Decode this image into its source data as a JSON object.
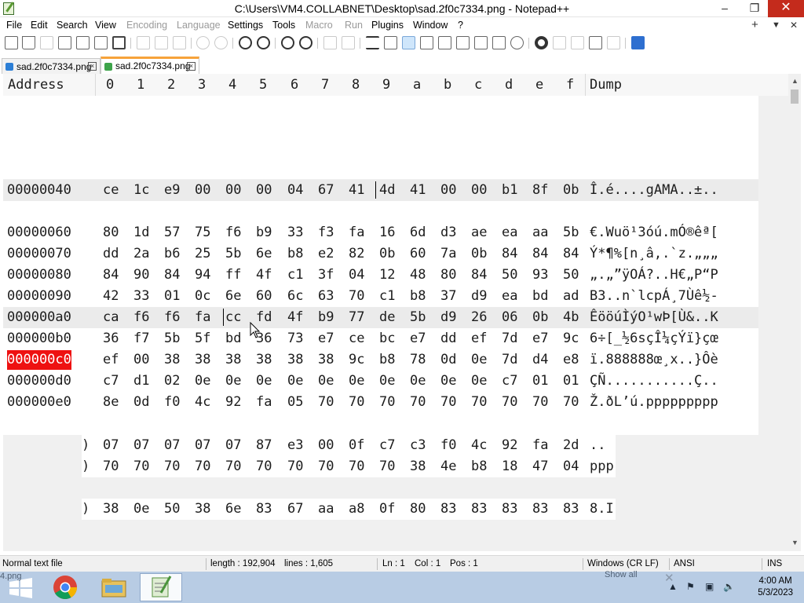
{
  "window": {
    "title": "C:\\Users\\VM4.COLLABNET\\Desktop\\sad.2f0c7334.png - Notepad++",
    "controls": [
      "–",
      "❐",
      "✕"
    ]
  },
  "menu": {
    "items": [
      "File",
      "Edit",
      "Search",
      "View",
      "Encoding",
      "Language",
      "Settings",
      "Tools",
      "Macro",
      "Run",
      "Plugins",
      "Window",
      "?"
    ],
    "disabled": [
      "Encoding",
      "Language",
      "Macro",
      "Run"
    ],
    "right": [
      "+",
      "▼",
      "✕"
    ]
  },
  "tabs": [
    {
      "label": "sad.2f0c7334.png",
      "active": false
    },
    {
      "label": "sad.2f0c7334.png",
      "active": true
    }
  ],
  "hex": {
    "header": {
      "address": "Address",
      "columns": [
        "0",
        "1",
        "2",
        "3",
        "4",
        "5",
        "6",
        "7",
        "8",
        "9",
        "a",
        "b",
        "c",
        "d",
        "e",
        "f"
      ],
      "dump": "Dump"
    },
    "rows": [
      {
        "address": "00000040",
        "bytes": [
          "ce",
          "1c",
          "e9",
          "00",
          "00",
          "00",
          "04",
          "67",
          "41",
          "4d",
          "41",
          "00",
          "00",
          "b1",
          "8f",
          "0b"
        ],
        "dump": "Î.é....gAMA..±.."
      },
      {
        "address": "00000060",
        "bytes": [
          "80",
          "1d",
          "57",
          "75",
          "f6",
          "b9",
          "33",
          "f3",
          "fa",
          "16",
          "6d",
          "d3",
          "ae",
          "ea",
          "aa",
          "5b"
        ],
        "dump": "€.Wuö¹3óú.mÓ®êª["
      },
      {
        "address": "00000070",
        "bytes": [
          "dd",
          "2a",
          "b6",
          "25",
          "5b",
          "6e",
          "b8",
          "e2",
          "82",
          "0b",
          "60",
          "7a",
          "0b",
          "84",
          "84",
          "84"
        ],
        "dump": "Ý*¶%[n¸â‚.`z.„„„"
      },
      {
        "address": "00000080",
        "bytes": [
          "84",
          "90",
          "84",
          "94",
          "ff",
          "4f",
          "c1",
          "3f",
          "04",
          "12",
          "48",
          "80",
          "84",
          "50",
          "93",
          "50"
        ],
        "dump": "„.„”ÿOÁ?..H€„P“P"
      },
      {
        "address": "00000090",
        "bytes": [
          "42",
          "33",
          "01",
          "0c",
          "6e",
          "60",
          "6c",
          "63",
          "70",
          "c1",
          "b8",
          "37",
          "d9",
          "ea",
          "bd",
          "ad"
        ],
        "dump": "B3..n`lcpÁ¸7Ùê½-"
      },
      {
        "address": "000000a0",
        "bytes": [
          "ca",
          "f6",
          "f6",
          "fa",
          "cc",
          "fd",
          "4f",
          "b9",
          "77",
          "de",
          "5b",
          "d9",
          "26",
          "06",
          "0b",
          "4b"
        ],
        "dump": "ÊööúÌýO¹wÞ[Ù&..K"
      },
      {
        "address": "000000b0",
        "bytes": [
          "36",
          "f7",
          "5b",
          "5f",
          "bd",
          "36",
          "73",
          "e7",
          "ce",
          "bc",
          "e7",
          "dd",
          "ef",
          "7d",
          "e7",
          "9c"
        ],
        "dump": "6÷[_½6sçÎ¼çÝï}çœ"
      },
      {
        "address": "000000c0",
        "bytes": [
          "ef",
          "00",
          "38",
          "38",
          "38",
          "38",
          "38",
          "38",
          "9c",
          "b8",
          "78",
          "0d",
          "0e",
          "7d",
          "d4",
          "e8"
        ],
        "dump": "ï.888888œ¸x..}Ôè"
      },
      {
        "address": "000000d0",
        "bytes": [
          "c7",
          "d1",
          "02",
          "0e",
          "0e",
          "0e",
          "0e",
          "0e",
          "0e",
          "0e",
          "0e",
          "0e",
          "0e",
          "c7",
          "01",
          "01"
        ],
        "dump": "ÇÑ...........Ç.."
      },
      {
        "address": "000000e0",
        "bytes": [
          "8e",
          "0d",
          "f0",
          "4c",
          "92",
          "fa",
          "05",
          "70",
          "70",
          "70",
          "70",
          "70",
          "70",
          "70",
          "70",
          "70"
        ],
        "dump": "Ž.ðL’ú.ppppppppp"
      }
    ],
    "partial_rows": [
      {
        "bytes": [
          ")",
          "07",
          "07",
          "07",
          "07",
          "07",
          "87",
          "e3",
          "00",
          "0f",
          "c7",
          "c3",
          "f0",
          "4c",
          "92",
          "fa",
          "2d"
        ],
        "dump": ".."
      },
      {
        "bytes": [
          ")",
          "70",
          "70",
          "70",
          "70",
          "70",
          "70",
          "70",
          "70",
          "70",
          "70",
          "38",
          "4e",
          "b8",
          "18",
          "47",
          "04"
        ],
        "dump": "ppp"
      },
      {
        "bytes": [
          ")",
          "38",
          "0e",
          "50",
          "38",
          "6e",
          "83",
          "67",
          "aa",
          "a8",
          "0f",
          "80",
          "83",
          "83",
          "83",
          "83",
          "83"
        ],
        "dump": "8.I"
      }
    ]
  },
  "status": {
    "type": "Normal text file",
    "length": "length : 192,904",
    "lines": "lines : 1,605",
    "ln": "Ln : 1",
    "col": "Col : 1",
    "pos": "Pos : 1",
    "eol": "Windows (CR LF)",
    "encoding": "ANSI",
    "mode": "INS"
  },
  "taskbar": {
    "ghost_left": "4.png",
    "ghost_show_all": "Show all",
    "time": "4:00 AM",
    "date": "5/3/2023",
    "apps": [
      "start-icon",
      "chrome-icon",
      "file-explorer-icon",
      "notepad-plus-plus-icon"
    ]
  },
  "colors": {
    "highlight_address": "#ee1111",
    "active_tab_accent": "#f7a33a",
    "taskbar": "#b8cce4",
    "close_button": "#c42b1c"
  }
}
